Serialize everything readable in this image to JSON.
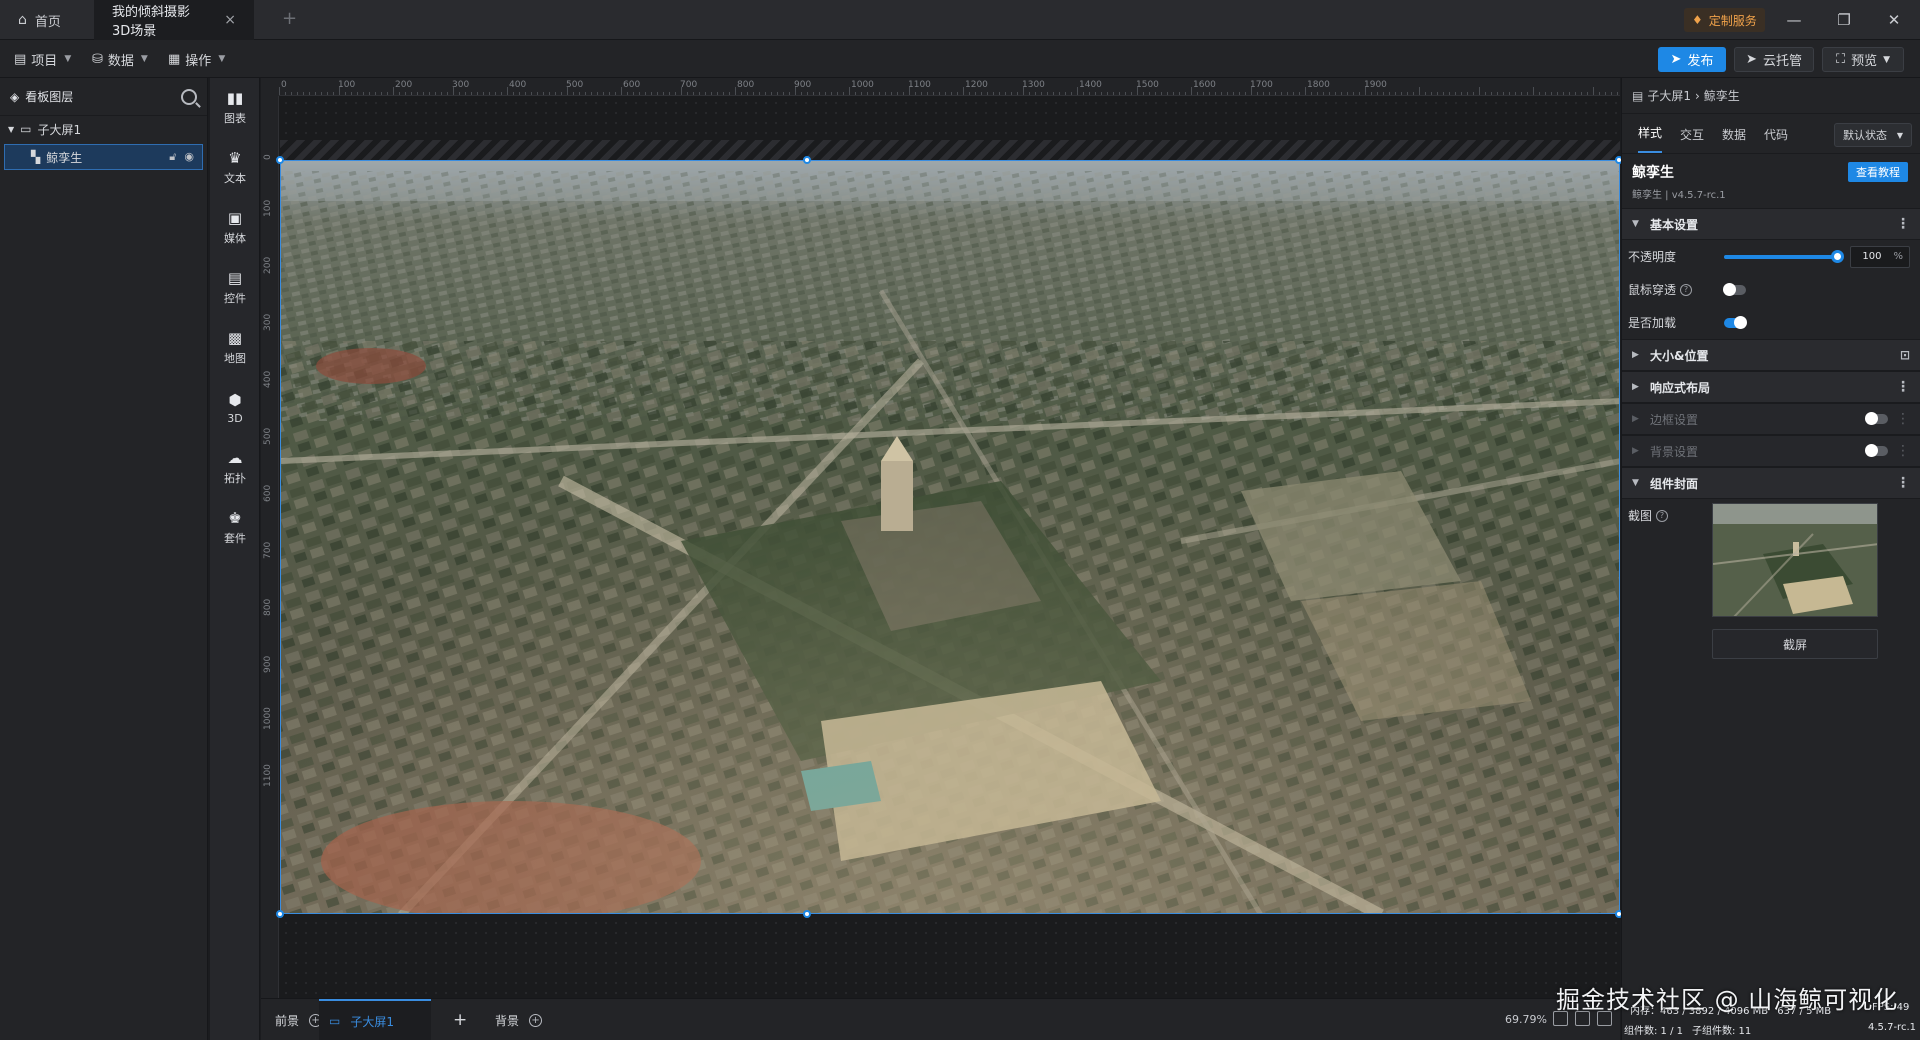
{
  "titlebar": {
    "home_tab": "首页",
    "active_tab": "我的倾斜摄影3D场景",
    "new_tab": "+",
    "custom_service": "定制服务"
  },
  "toolbar": {
    "menus": [
      "项目",
      "数据",
      "操作"
    ],
    "publish": "发布",
    "cloud_hosting": "云托管",
    "preview": "预览"
  },
  "layers": {
    "title": "看板图层",
    "group": "子大屏1",
    "item": "鲸孪生"
  },
  "components": [
    {
      "label": "图表",
      "icon": "chart-icon"
    },
    {
      "label": "文本",
      "icon": "text-icon"
    },
    {
      "label": "媒体",
      "icon": "media-icon"
    },
    {
      "label": "控件",
      "icon": "control-icon"
    },
    {
      "label": "地图",
      "icon": "map-icon"
    },
    {
      "label": "3D",
      "icon": "cube-icon"
    },
    {
      "label": "拓扑",
      "icon": "topology-icon"
    },
    {
      "label": "套件",
      "icon": "kit-icon"
    }
  ],
  "ruler": {
    "h": [
      "0",
      "100",
      "200",
      "300",
      "400",
      "500",
      "600",
      "700",
      "800",
      "900",
      "1000",
      "1100",
      "1200",
      "1300",
      "1400",
      "1500",
      "1600",
      "1700",
      "1800",
      "1900"
    ],
    "v": [
      "0",
      "100",
      "200",
      "300",
      "400",
      "500",
      "600",
      "700",
      "800",
      "900",
      "1000",
      "1100"
    ]
  },
  "bottom": {
    "foreground": "前景",
    "screen_tab": "子大屏1",
    "add": "+",
    "background": "背景",
    "zoom": "69.79%"
  },
  "props": {
    "breadcrumb_parent": "子大屏1",
    "breadcrumb_sep": "›",
    "breadcrumb_current": "鲸孪生",
    "tabs": [
      "样式",
      "交互",
      "数据",
      "代码"
    ],
    "state_select": "默认状态",
    "component_name": "鲸孪生",
    "component_version": "鲸孪生 | v4.5.7-rc.1",
    "tutorial": "查看教程",
    "sections": {
      "basic": "基本设置",
      "size_position": "大小&位置",
      "responsive": "响应式布局",
      "border": "边框设置",
      "background": "背景设置",
      "cover": "组件封面"
    },
    "opacity_label": "不透明度",
    "opacity_value": "100",
    "opacity_unit": "%",
    "opacity_fraction": 1.0,
    "mouse_through_label": "鼠标穿透",
    "mouse_through": false,
    "load_label": "是否加载",
    "load": true,
    "screenshot_label": "截图",
    "screenshot_button": "截屏"
  },
  "status": {
    "line1_prefix": "内存：",
    "line1_value": "463 / 3892 / 4096 MB",
    "line1_suffix": "637 / 5 MB",
    "fps": "FPS: 49",
    "component_count": "组件数: 1 / 1",
    "child_count": "子组件数: 11",
    "version": "4.5.7-rc.1"
  },
  "watermark": "掘金技术社区 @ 山海鲸可视化",
  "colors": {
    "accent": "#1e88e5",
    "panel": "#232427",
    "canvas": "#1a1b1d",
    "service": "#f0a24a"
  }
}
